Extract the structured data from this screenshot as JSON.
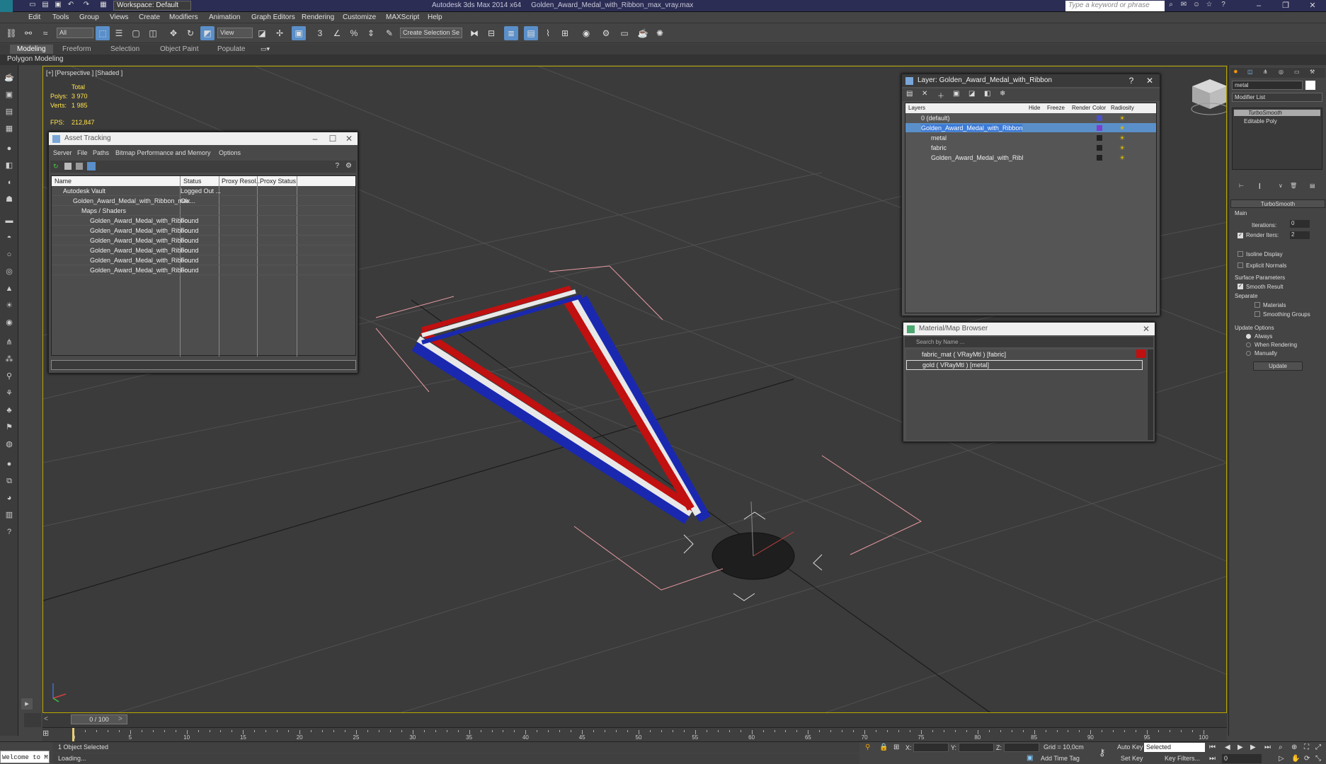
{
  "titlebar": {
    "app_title": "Autodesk 3ds Max 2014 x64",
    "file_name": "Golden_Award_Medal_with_Ribbon_max_vray.max",
    "workspace": "Workspace: Default",
    "search_placeholder": "Type a keyword or phrase"
  },
  "menu": [
    "Edit",
    "Tools",
    "Group",
    "Views",
    "Create",
    "Modifiers",
    "Animation",
    "Graph Editors",
    "Rendering",
    "Customize",
    "MAXScript",
    "Help"
  ],
  "toolbar": {
    "filter_value": "All",
    "refcoord_value": "View",
    "selection_set_placeholder": "Create Selection Se"
  },
  "ribbon": {
    "tabs": [
      "Modeling",
      "Freeform",
      "Selection",
      "Object Paint",
      "Populate"
    ],
    "active_tab": "Modeling",
    "sub_label": "Polygon Modeling"
  },
  "viewport": {
    "label": "[+] [Perspective ] [Shaded ]",
    "stats": {
      "total_label": "Total",
      "polys_label": "Polys:",
      "polys_value": "3 970",
      "verts_label": "Verts:",
      "verts_value": "1 985",
      "fps_label": "FPS:",
      "fps_value": "212,847"
    }
  },
  "asset_tracking": {
    "title": "Asset Tracking",
    "menu": [
      "Server",
      "File",
      "Paths",
      "Bitmap Performance and Memory",
      "Options"
    ],
    "columns": [
      "Name",
      "Status",
      "Proxy Resol...",
      "Proxy Status"
    ],
    "rows": [
      {
        "name": "Autodesk Vault",
        "status": "Logged Out ..."
      },
      {
        "name": "Golden_Award_Medal_with_Ribbon_max...",
        "status": "Ok"
      },
      {
        "name": "Maps / Shaders",
        "status": ""
      },
      {
        "name": "Golden_Award_Medal_with_Ribbo...",
        "status": "Found"
      },
      {
        "name": "Golden_Award_Medal_with_Ribbo...",
        "status": "Found"
      },
      {
        "name": "Golden_Award_Medal_with_Ribbo...",
        "status": "Found"
      },
      {
        "name": "Golden_Award_Medal_with_Ribbo...",
        "status": "Found"
      },
      {
        "name": "Golden_Award_Medal_with_Ribbo...",
        "status": "Found"
      },
      {
        "name": "Golden_Award_Medal_with_Ribbo...",
        "status": "Found"
      }
    ]
  },
  "layer_window": {
    "title": "Layer: Golden_Award_Medal_with_Ribbon",
    "help": "?",
    "columns": [
      "Layers",
      "Hide",
      "Freeze",
      "Render",
      "Color",
      "Radiosity"
    ],
    "rows": [
      {
        "name": "0 (default)",
        "color": "#4a50c8"
      },
      {
        "name": "Golden_Award_Medal_with_Ribbon",
        "color": "#7a3fd0"
      },
      {
        "name": "metal",
        "color": "#222222"
      },
      {
        "name": "fabric",
        "color": "#222222"
      },
      {
        "name": "Golden_Award_Medal_with_Ribl",
        "color": "#222222"
      }
    ]
  },
  "material_browser": {
    "title": "Material/Map Browser",
    "search_placeholder": "Search by Name ...",
    "items": [
      "fabric_mat  ( VRayMtl ) [fabric]",
      "gold  ( VRayMtl ) [metal]"
    ]
  },
  "command_panel": {
    "name_value": "metal",
    "modifier_list": "Modifier List",
    "stack": [
      "TurboSmooth",
      "Editable Poly"
    ],
    "rollout_title": "TurboSmooth",
    "main_label": "Main",
    "iterations_label": "Iterations:",
    "iterations_value": "0",
    "render_iters_label": "Render Iters:",
    "render_iters_value": "2",
    "isoline_label": "Isoline Display",
    "explicit_label": "Explicit Normals",
    "surface_label": "Surface Parameters",
    "smooth_result_label": "Smooth Result",
    "separate_label": "Separate",
    "materials_label": "Materials",
    "smoothing_groups_label": "Smoothing Groups",
    "update_options_label": "Update Options",
    "always_label": "Always",
    "when_rendering_label": "When Rendering",
    "manually_label": "Manually",
    "update_button": "Update"
  },
  "timeline": {
    "frame_counter": "0 / 100",
    "ticks": [
      "0",
      "5",
      "10",
      "15",
      "20",
      "25",
      "30",
      "35",
      "40",
      "45",
      "50",
      "55",
      "60",
      "65",
      "70",
      "75",
      "80",
      "85",
      "90",
      "95",
      "100"
    ]
  },
  "statusbar": {
    "maxscript_text": "Welcome to M",
    "selection_text": "1 Object Selected",
    "prompt_text": "Loading...",
    "x_label": "X:",
    "y_label": "Y:",
    "z_label": "Z:",
    "grid_text": "Grid = 10,0cm",
    "add_time_tag": "Add Time Tag",
    "auto_key": "Auto Key",
    "selected_value": "Selected",
    "set_key": "Set Key",
    "key_filters": "Key Filters...",
    "frame_value": "0"
  }
}
